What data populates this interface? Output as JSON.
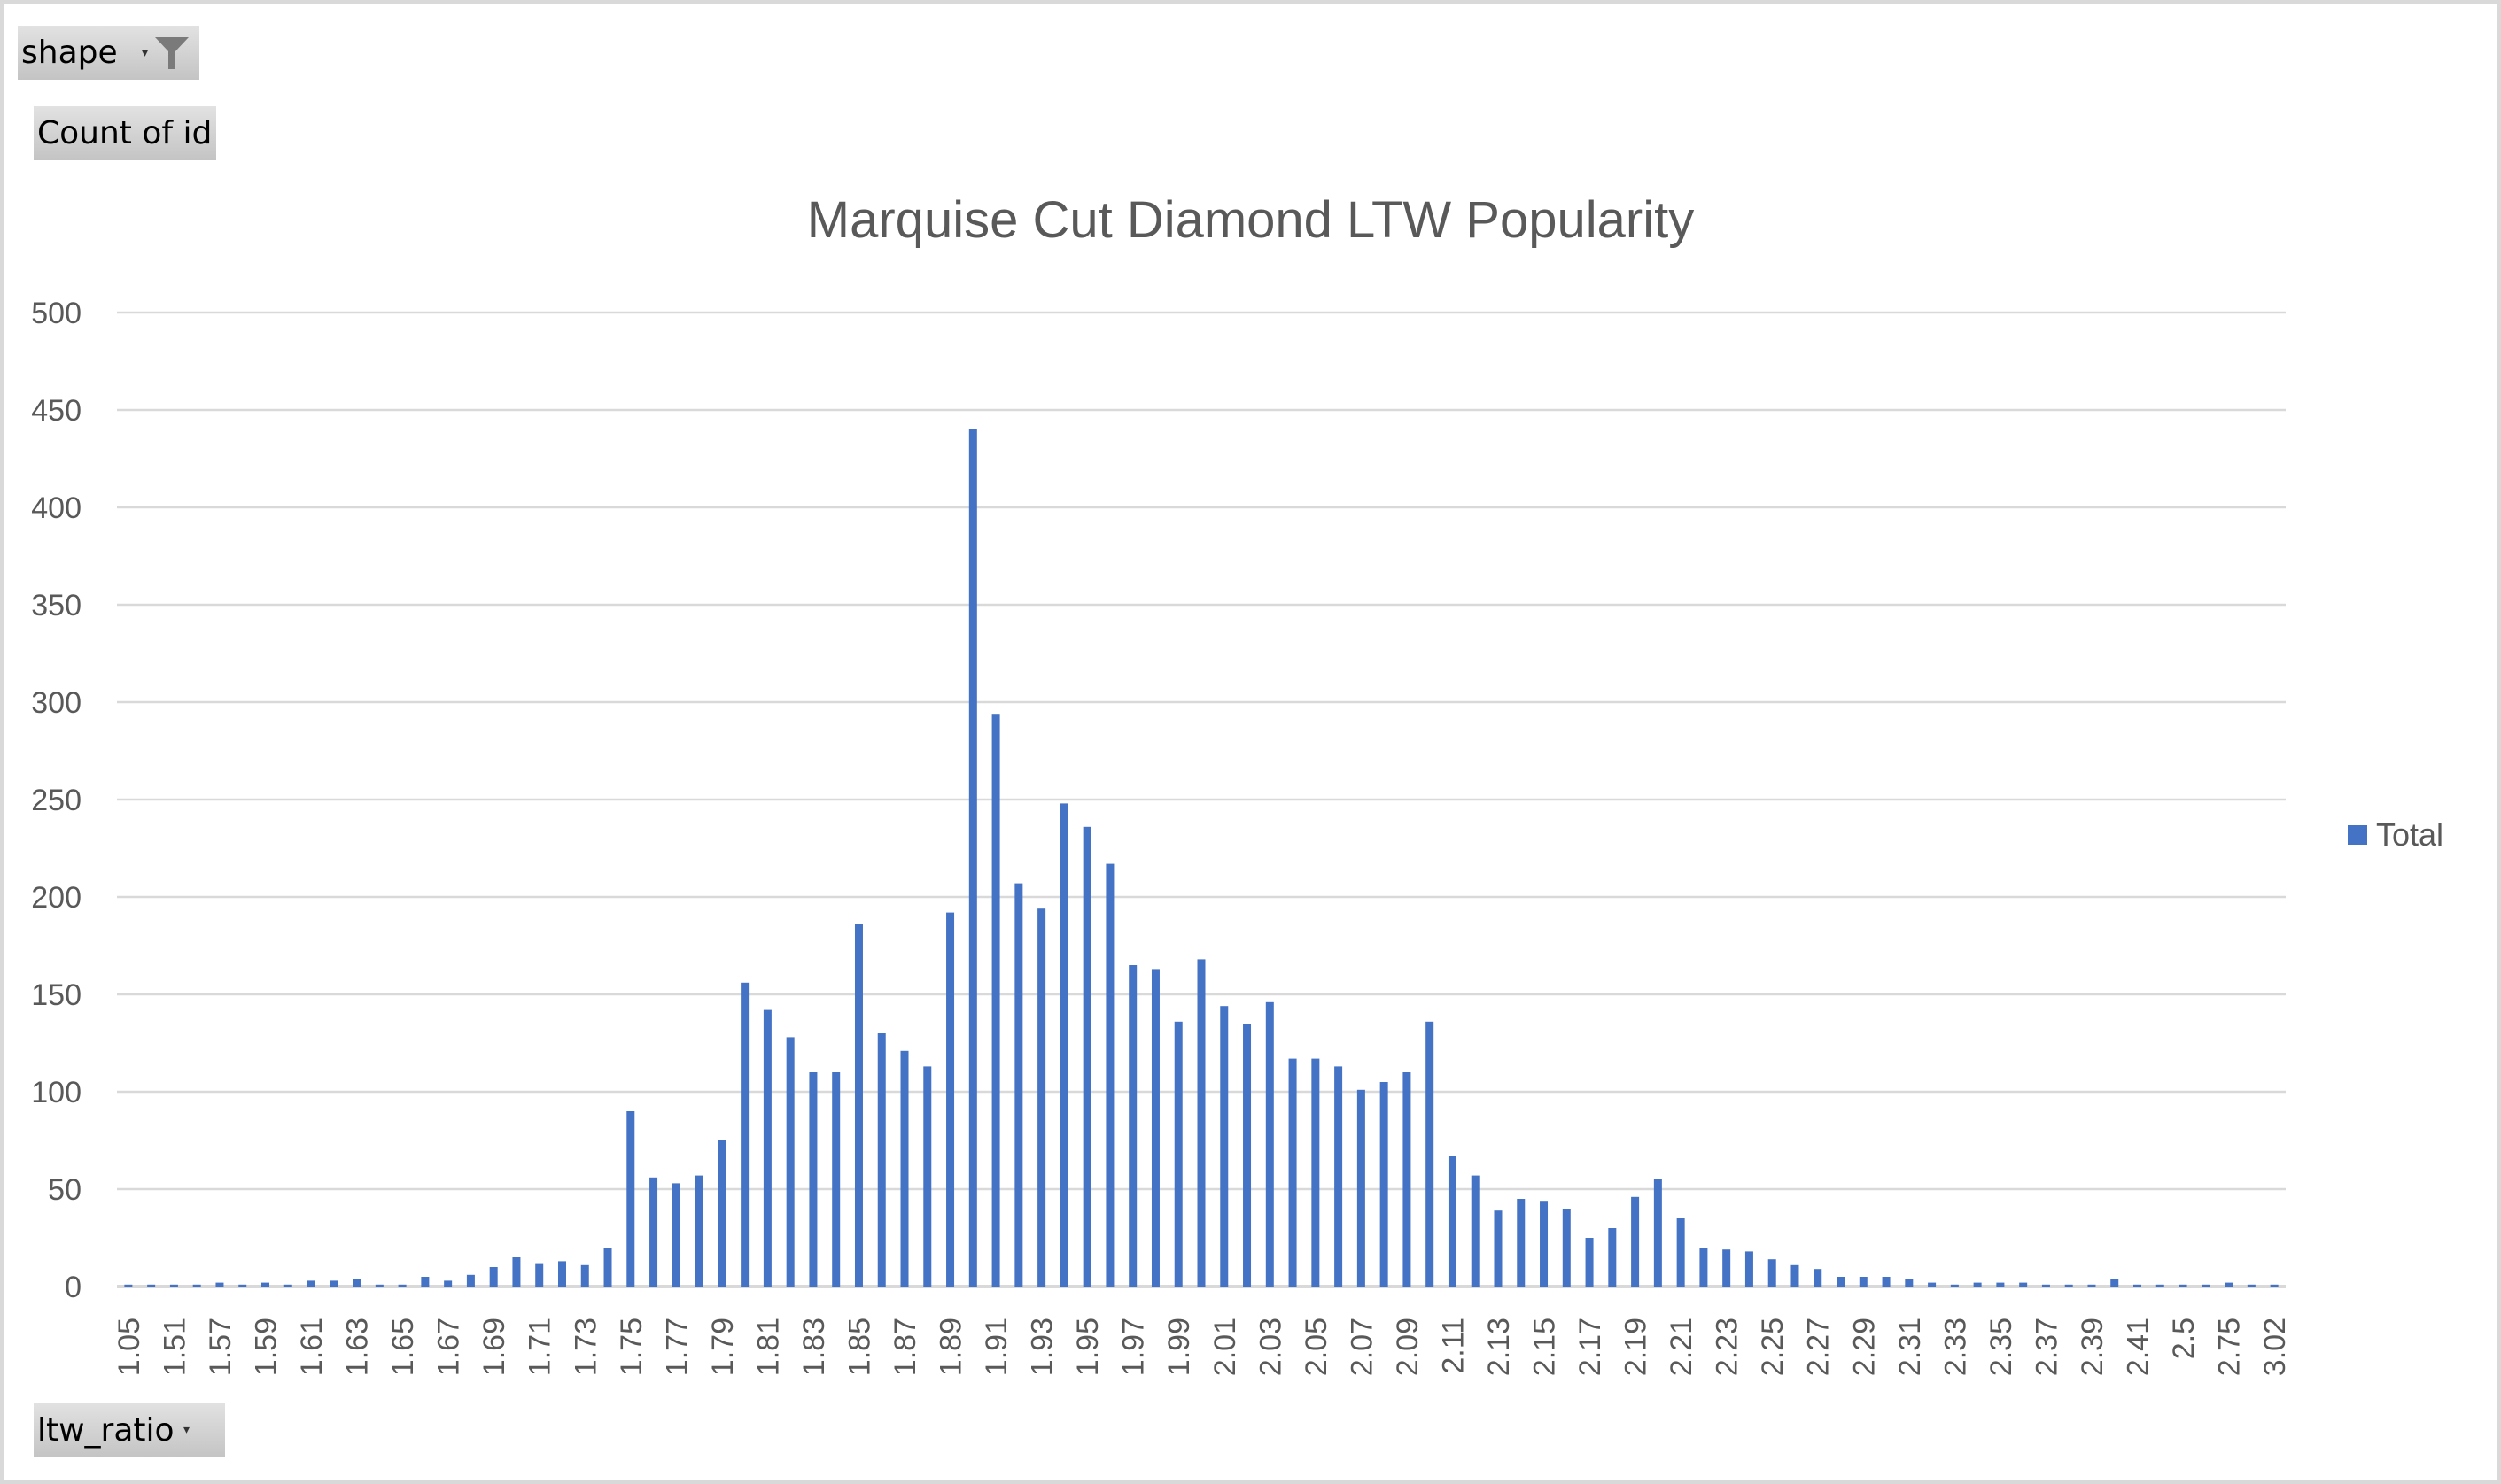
{
  "pivot_fields": {
    "filter": {
      "label": "shape",
      "icon": "filter-icon",
      "has_active_filter": true
    },
    "values": {
      "label": "Count of id"
    },
    "axis": {
      "label": "ltw_ratio"
    }
  },
  "chart_data": {
    "type": "bar",
    "title": "Marquise Cut Diamond LTW Popularity",
    "xlabel": "",
    "ylabel": "",
    "ylim": [
      0,
      500
    ],
    "yticks": [
      0,
      50,
      100,
      150,
      200,
      250,
      300,
      350,
      400,
      450,
      500
    ],
    "grid": true,
    "legend": {
      "position": "right",
      "entries": [
        "Total"
      ]
    },
    "series_color": "#4472c4",
    "categories": [
      "1.05",
      "",
      "1.51",
      "",
      "1.57",
      "",
      "1.59",
      "",
      "1.61",
      "",
      "1.63",
      "",
      "1.65",
      "",
      "1.67",
      "",
      "1.69",
      "",
      "1.71",
      "",
      "1.73",
      "",
      "1.75",
      "",
      "1.77",
      "",
      "1.79",
      "",
      "1.81",
      "",
      "1.83",
      "",
      "1.85",
      "",
      "1.87",
      "",
      "1.89",
      "",
      "1.91",
      "",
      "1.93",
      "",
      "1.95",
      "",
      "1.97",
      "",
      "1.99",
      "",
      "2.01",
      "",
      "2.03",
      "",
      "2.05",
      "",
      "2.07",
      "",
      "2.09",
      "",
      "2.11",
      "",
      "2.13",
      "",
      "2.15",
      "",
      "2.17",
      "",
      "2.19",
      "",
      "2.21",
      "",
      "2.23",
      "",
      "2.25",
      "",
      "2.27",
      "",
      "2.29",
      "",
      "2.31",
      "",
      "2.33",
      "",
      "2.35",
      "",
      "2.37",
      "",
      "2.39",
      "",
      "2.41",
      "",
      "2.5",
      "",
      "2.75",
      "",
      "3.02"
    ],
    "series": [
      {
        "name": "Total",
        "values": [
          1,
          1,
          1,
          1,
          2,
          1,
          2,
          1,
          3,
          3,
          4,
          1,
          1,
          5,
          3,
          6,
          10,
          15,
          12,
          13,
          11,
          20,
          90,
          56,
          53,
          57,
          75,
          156,
          142,
          128,
          110,
          110,
          186,
          130,
          121,
          113,
          192,
          440,
          294,
          207,
          194,
          248,
          236,
          217,
          165,
          163,
          136,
          168,
          144,
          135,
          146,
          117,
          117,
          113,
          101,
          105,
          110,
          136,
          67,
          57,
          39,
          45,
          44,
          40,
          25,
          30,
          46,
          55,
          35,
          20,
          19,
          18,
          14,
          11,
          9,
          5,
          5,
          5,
          4,
          2,
          1,
          2,
          2,
          2,
          1,
          1,
          1,
          4,
          1,
          1,
          1,
          1,
          2,
          1,
          1
        ]
      }
    ]
  }
}
